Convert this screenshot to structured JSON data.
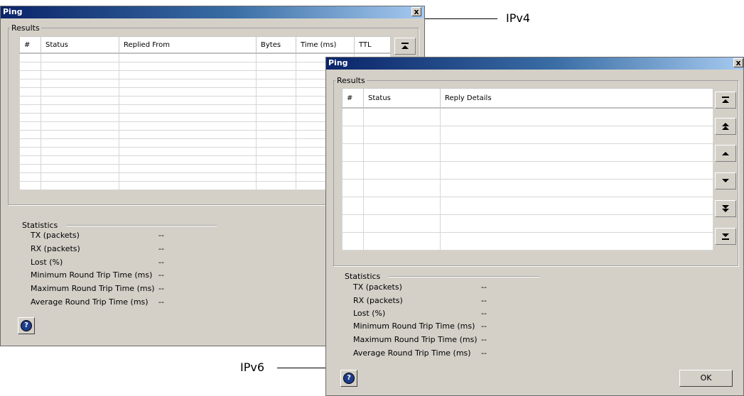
{
  "ipv4_window": {
    "title": "Ping",
    "close_label": "x",
    "results_label": "Results",
    "columns": [
      "#",
      "Status",
      "Replied From",
      "Bytes",
      "Time (ms)",
      "TTL"
    ],
    "statistics_label": "Statistics",
    "stats": [
      {
        "label": "TX (packets)",
        "value": "--"
      },
      {
        "label": "RX (packets)",
        "value": "--"
      },
      {
        "label": "Lost (%)",
        "value": "--"
      },
      {
        "label": "Minimum Round Trip Time (ms)",
        "value": "--"
      },
      {
        "label": "Maximum Round Trip Time (ms)",
        "value": "--"
      },
      {
        "label": "Average Round Trip Time (ms)",
        "value": "--"
      }
    ],
    "help_icon": "help-icon",
    "nav_icons": [
      "scroll-to-top-icon"
    ]
  },
  "ipv6_window": {
    "title": "Ping",
    "close_label": "x",
    "results_label": "Results",
    "columns": [
      "#",
      "Status",
      "Reply Details"
    ],
    "statistics_label": "Statistics",
    "stats": [
      {
        "label": "TX (packets)",
        "value": "--"
      },
      {
        "label": "RX (packets)",
        "value": "--"
      },
      {
        "label": "Lost (%)",
        "value": "--"
      },
      {
        "label": "Minimum Round Trip Time (ms)",
        "value": "--"
      },
      {
        "label": "Maximum Round Trip Time (ms)",
        "value": "--"
      },
      {
        "label": "Average Round Trip Time (ms)",
        "value": "--"
      }
    ],
    "ok_label": "OK",
    "help_icon": "help-icon",
    "nav_icons": [
      "scroll-to-top-icon",
      "page-up-icon",
      "line-up-icon",
      "line-down-icon",
      "page-down-icon",
      "scroll-to-bottom-icon"
    ]
  },
  "callouts": {
    "ipv4": "IPv4",
    "ipv6": "IPv6"
  },
  "colors": {
    "window_bg": "#d4d0c8",
    "titlebar_start": "#0a246a",
    "titlebar_end": "#a6caf0"
  }
}
